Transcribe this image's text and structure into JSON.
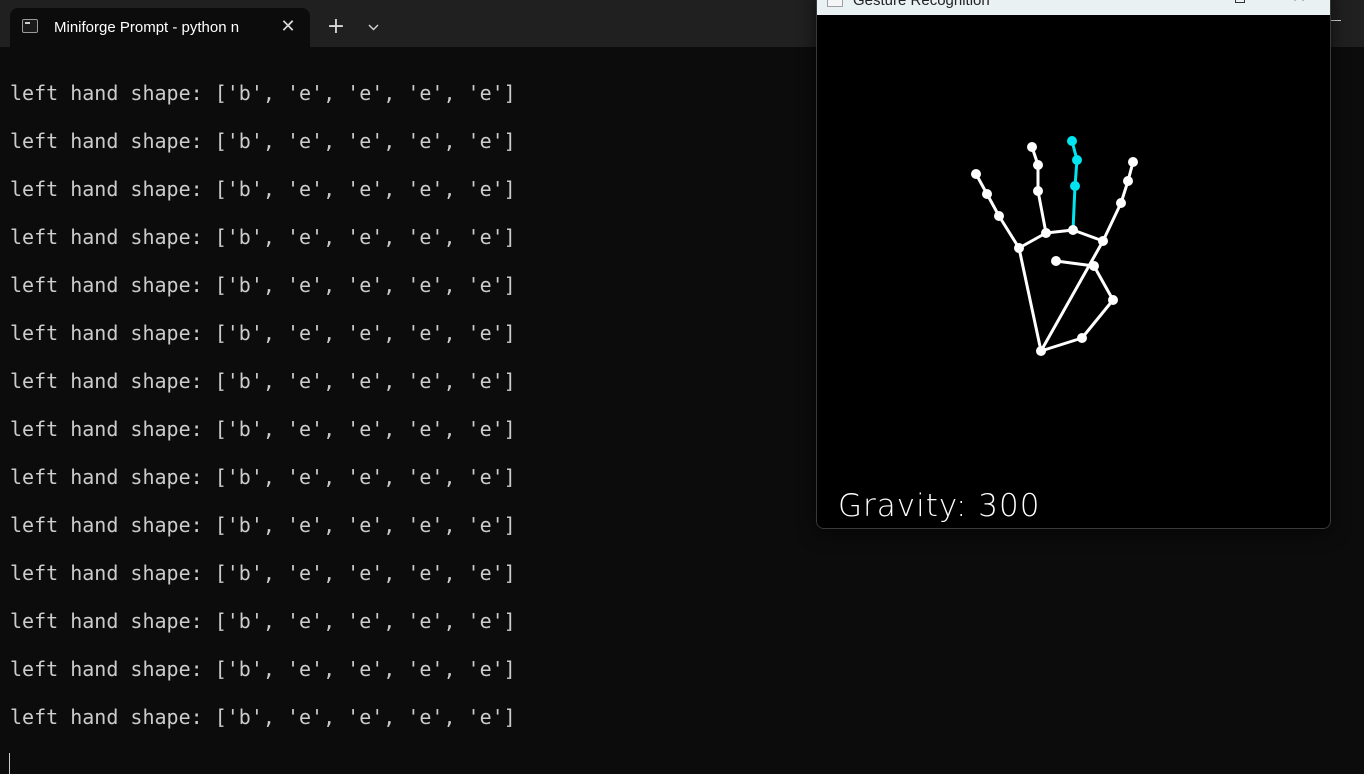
{
  "terminal_window": {
    "tab": {
      "title": "Miniforge Prompt - python  n",
      "close_glyph": "✕"
    },
    "new_tab_glyph": "+",
    "dropdown_icon": "chevron-down-icon",
    "app_icon": "terminal-icon"
  },
  "terminal": {
    "lines": [
      "left hand shape: ['b', 'e', 'e', 'e', 'e']",
      "left hand shape: ['b', 'e', 'e', 'e', 'e']",
      "left hand shape: ['b', 'e', 'e', 'e', 'e']",
      "left hand shape: ['b', 'e', 'e', 'e', 'e']",
      "left hand shape: ['b', 'e', 'e', 'e', 'e']",
      "left hand shape: ['b', 'e', 'e', 'e', 'e']",
      "left hand shape: ['b', 'e', 'e', 'e', 'e']",
      "left hand shape: ['b', 'e', 'e', 'e', 'e']",
      "left hand shape: ['b', 'e', 'e', 'e', 'e']",
      "left hand shape: ['b', 'e', 'e', 'e', 'e']",
      "left hand shape: ['b', 'e', 'e', 'e', 'e']",
      "left hand shape: ['b', 'e', 'e', 'e', 'e']",
      "left hand shape: ['b', 'e', 'e', 'e', 'e']",
      "left hand shape: ['b', 'e', 'e', 'e', 'e']"
    ],
    "text_color": "#cccccc",
    "background_color": "#0c0c0c"
  },
  "gesture_window": {
    "title": "Gesture Recognition",
    "close_glyph": "✕",
    "gravity_label": "Gravity: 300",
    "skeleton_color": "#ffffff",
    "highlight_color": "#00e5f0"
  }
}
